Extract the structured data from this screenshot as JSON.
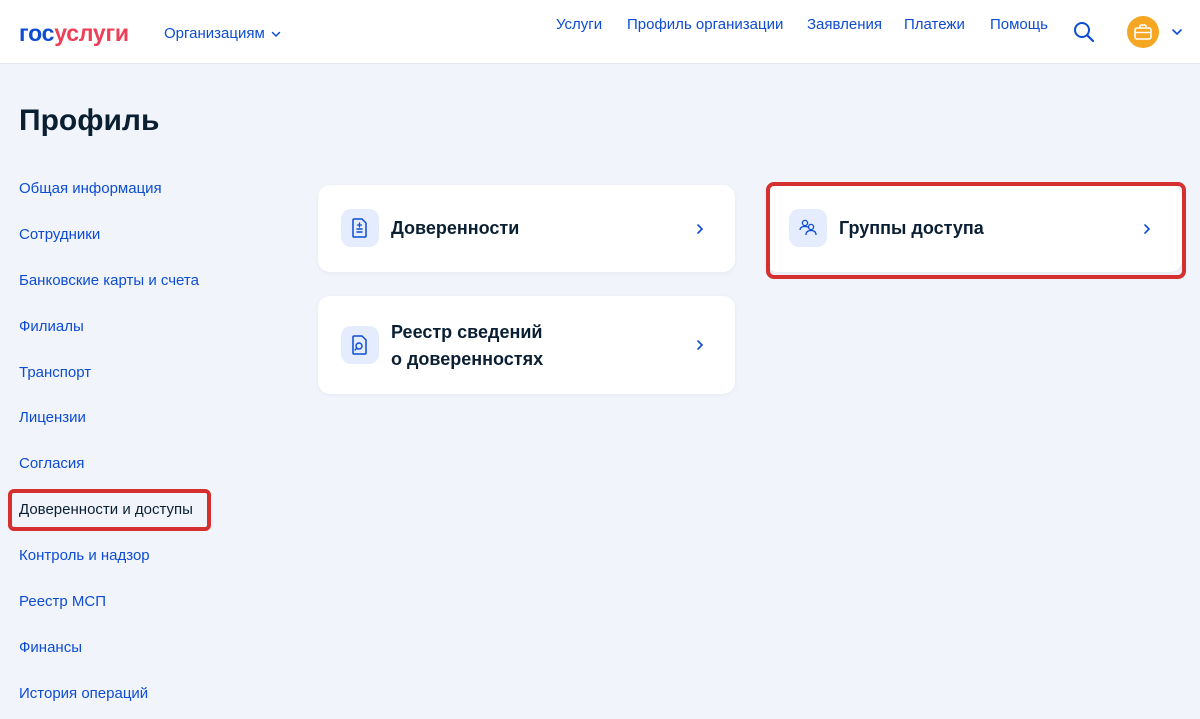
{
  "header": {
    "logo_part1": "гос",
    "logo_part2": "услуги",
    "org_dropdown_label": "Организациям",
    "nav": [
      "Услуги",
      "Профиль организации",
      "Заявления",
      "Платежи",
      "Помощь"
    ],
    "search_icon": "search-icon",
    "avatar_icon": "briefcase-icon"
  },
  "page": {
    "title": "Профиль"
  },
  "sidebar": {
    "items": [
      "Общая информация",
      "Сотрудники",
      "Банковские карты и счета",
      "Филиалы",
      "Транспорт",
      "Лицензии",
      "Согласия",
      "Доверенности и доступы",
      "Контроль и надзор",
      "Реестр МСП",
      "Финансы",
      "История операций"
    ],
    "active_index": 7
  },
  "cards": {
    "powers": {
      "title": "Доверенности",
      "icon": "document-icon"
    },
    "registry": {
      "title_line1": "Реестр сведений",
      "title_line2": "о доверенностях",
      "icon": "document-search-icon"
    },
    "groups": {
      "title": "Группы доступа",
      "icon": "people-group-icon"
    }
  },
  "colors": {
    "brand_blue": "#0d4cd3",
    "brand_red": "#ee3f58",
    "highlight": "#d62f2f",
    "background": "#f1f5fb",
    "avatar": "#f5a623"
  }
}
